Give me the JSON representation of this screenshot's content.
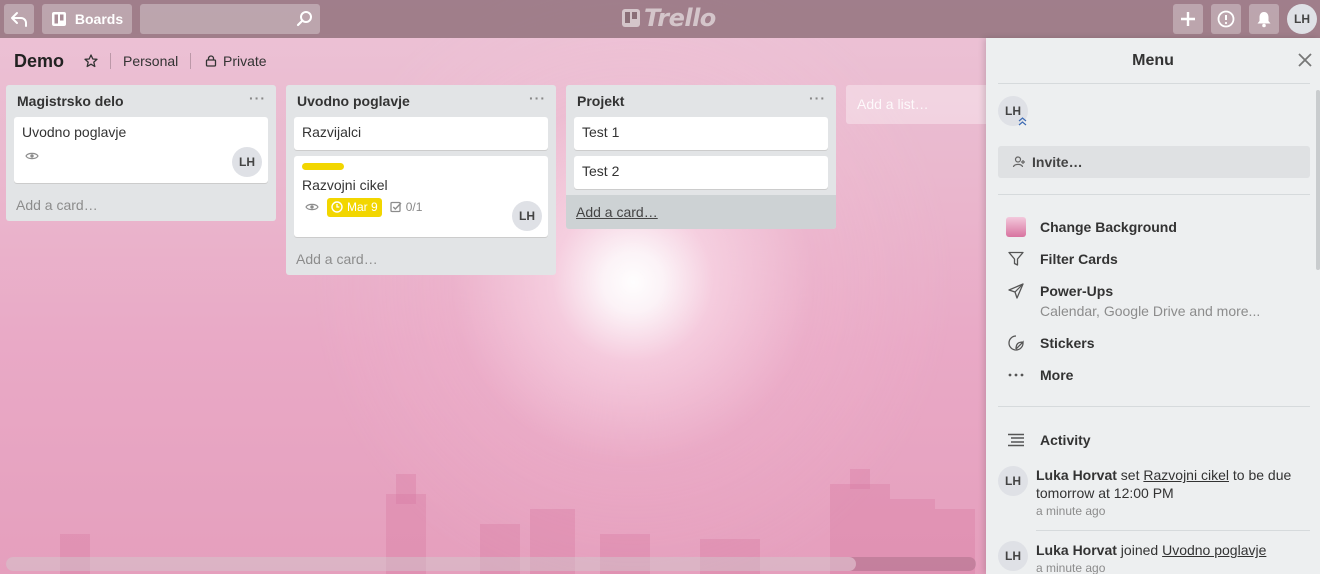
{
  "header": {
    "back_icon": "back-arrow-icon",
    "boards_label": "Boards",
    "search_placeholder": "",
    "logo_text": "Trello",
    "user_initials": "LH"
  },
  "board": {
    "title": "Demo",
    "team": "Personal",
    "visibility": "Private"
  },
  "lists": [
    {
      "title": "Magistrsko delo",
      "cards": [
        {
          "title": "Uvodno poglavje",
          "member": "LH"
        }
      ],
      "add_card": "Add a card…"
    },
    {
      "title": "Uvodno poglavje",
      "cards": [
        {
          "title": "Razvijalci"
        },
        {
          "title": "Razvojni cikel",
          "label_color": "#f2d600",
          "due": "Mar 9",
          "checklist": "0/1",
          "member": "LH"
        }
      ],
      "add_card": "Add a card…"
    },
    {
      "title": "Projekt",
      "cards": [
        {
          "title": "Test 1"
        },
        {
          "title": "Test 2"
        }
      ],
      "add_card": "Add a card…"
    }
  ],
  "add_list": "Add a list…",
  "menu": {
    "title": "Menu",
    "member_initials": "LH",
    "invite_label": "Invite…",
    "items": [
      {
        "label": "Change Background"
      },
      {
        "label": "Filter Cards"
      },
      {
        "label": "Power-Ups",
        "sub": "Calendar, Google Drive and more..."
      },
      {
        "label": "Stickers"
      },
      {
        "label": "More"
      }
    ],
    "activity_title": "Activity",
    "activity": [
      {
        "initials": "LH",
        "user": "Luka Horvat",
        "action": " set ",
        "target": "Razvojni cikel",
        "rest": " to be due tomorrow at 12:00 PM",
        "time": "a minute ago"
      },
      {
        "initials": "LH",
        "user": "Luka Horvat",
        "action": " joined ",
        "target": "Uvodno poglavje",
        "rest": "",
        "time": "a minute ago"
      }
    ]
  },
  "colors": {
    "label_yellow": "#f2d600",
    "list_bg": "#e2e4e6",
    "menu_bg": "#edeff0"
  }
}
